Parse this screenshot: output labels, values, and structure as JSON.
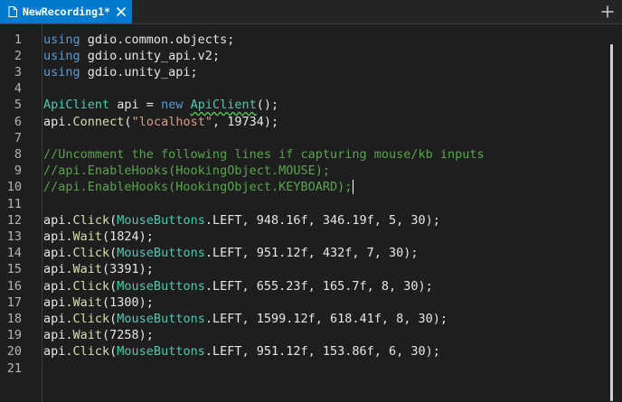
{
  "tab": {
    "title": "NewRecording1*"
  },
  "icons": {
    "file": "file-icon",
    "close": "close-icon",
    "plus": "new-tab-icon"
  },
  "colors": {
    "accent": "#007acc",
    "keyword": "#569cd6",
    "type": "#4ec9b0",
    "method": "#dcdcaa",
    "string": "#d69d85",
    "comment": "#57a64a",
    "text": "#e6e6e6"
  },
  "editor": {
    "line_numbers": [
      "1",
      "2",
      "3",
      "4",
      "5",
      "6",
      "7",
      "8",
      "9",
      "10",
      "11",
      "12",
      "13",
      "14",
      "15",
      "16",
      "17",
      "18",
      "19",
      "20",
      "21"
    ],
    "lines": [
      [
        {
          "t": "using",
          "c": "kw"
        },
        {
          "t": " gdio.common.objects;",
          "c": "plain"
        }
      ],
      [
        {
          "t": "using",
          "c": "kw"
        },
        {
          "t": " gdio.unity_api.v2;",
          "c": "plain"
        }
      ],
      [
        {
          "t": "using",
          "c": "kw"
        },
        {
          "t": " gdio.unity_api;",
          "c": "plain"
        }
      ],
      [],
      [
        {
          "t": "ApiClient",
          "c": "ty"
        },
        {
          "t": " api = ",
          "c": "plain"
        },
        {
          "t": "new",
          "c": "kw"
        },
        {
          "t": " ",
          "c": "plain"
        },
        {
          "t": "ApiClient",
          "c": "ty",
          "squiggle": true
        },
        {
          "t": "();",
          "c": "plain"
        }
      ],
      [
        {
          "t": "api.",
          "c": "plain"
        },
        {
          "t": "Connect",
          "c": "fn"
        },
        {
          "t": "(",
          "c": "plain"
        },
        {
          "t": "\"localhost\"",
          "c": "str"
        },
        {
          "t": ", 19734);",
          "c": "plain"
        }
      ],
      [],
      [
        {
          "t": "//Uncomment the following lines if capturing mouse/kb inputs",
          "c": "cm"
        }
      ],
      [
        {
          "t": "//api.EnableHooks(HookingObject.MOUSE);",
          "c": "cm"
        }
      ],
      [
        {
          "t": "//api.EnableHooks(HookingObject.KEYBOARD);",
          "c": "cm"
        }
      ],
      [],
      [
        {
          "t": "api.",
          "c": "plain"
        },
        {
          "t": "Click",
          "c": "fn"
        },
        {
          "t": "(",
          "c": "plain"
        },
        {
          "t": "MouseButtons",
          "c": "ty"
        },
        {
          "t": ".LEFT, 948.16f, 346.19f, 5, 30);",
          "c": "plain"
        }
      ],
      [
        {
          "t": "api.",
          "c": "plain"
        },
        {
          "t": "Wait",
          "c": "fn"
        },
        {
          "t": "(1824);",
          "c": "plain"
        }
      ],
      [
        {
          "t": "api.",
          "c": "plain"
        },
        {
          "t": "Click",
          "c": "fn"
        },
        {
          "t": "(",
          "c": "plain"
        },
        {
          "t": "MouseButtons",
          "c": "ty"
        },
        {
          "t": ".LEFT, 951.12f, 432f, 7, 30);",
          "c": "plain"
        }
      ],
      [
        {
          "t": "api.",
          "c": "plain"
        },
        {
          "t": "Wait",
          "c": "fn"
        },
        {
          "t": "(3391);",
          "c": "plain"
        }
      ],
      [
        {
          "t": "api.",
          "c": "plain"
        },
        {
          "t": "Click",
          "c": "fn"
        },
        {
          "t": "(",
          "c": "plain"
        },
        {
          "t": "MouseButtons",
          "c": "ty"
        },
        {
          "t": ".LEFT, 655.23f, 165.7f, 8, 30);",
          "c": "plain"
        }
      ],
      [
        {
          "t": "api.",
          "c": "plain"
        },
        {
          "t": "Wait",
          "c": "fn"
        },
        {
          "t": "(1300);",
          "c": "plain"
        }
      ],
      [
        {
          "t": "api.",
          "c": "plain"
        },
        {
          "t": "Click",
          "c": "fn"
        },
        {
          "t": "(",
          "c": "plain"
        },
        {
          "t": "MouseButtons",
          "c": "ty"
        },
        {
          "t": ".LEFT, 1599.12f, 618.41f, 8, 30);",
          "c": "plain"
        }
      ],
      [
        {
          "t": "api.",
          "c": "plain"
        },
        {
          "t": "Wait",
          "c": "fn"
        },
        {
          "t": "(7258);",
          "c": "plain"
        }
      ],
      [
        {
          "t": "api.",
          "c": "plain"
        },
        {
          "t": "Click",
          "c": "fn"
        },
        {
          "t": "(",
          "c": "plain"
        },
        {
          "t": "MouseButtons",
          "c": "ty"
        },
        {
          "t": ".LEFT, 951.12f, 153.86f, 6, 30);",
          "c": "plain"
        }
      ],
      []
    ]
  }
}
